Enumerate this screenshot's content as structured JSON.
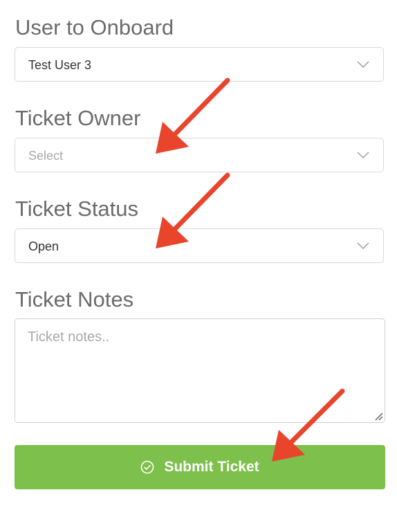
{
  "fields": {
    "user_to_onboard": {
      "label": "User to Onboard",
      "value": "Test User 3"
    },
    "ticket_owner": {
      "label": "Ticket Owner",
      "placeholder": "Select"
    },
    "ticket_status": {
      "label": "Ticket Status",
      "value": "Open"
    },
    "ticket_notes": {
      "label": "Ticket Notes",
      "placeholder": "Ticket notes.."
    }
  },
  "submit": {
    "label": "Submit Ticket",
    "icon": "check-circle-icon",
    "color": "#7dc04b"
  },
  "annotations": {
    "arrow_color": "#e8452c",
    "arrow_icon": "red-arrow-annotation"
  }
}
